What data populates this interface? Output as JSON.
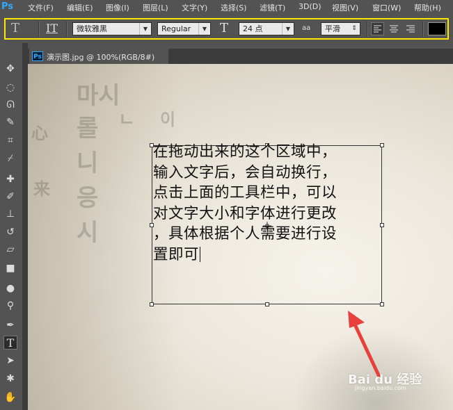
{
  "app": {
    "logo": "Ps"
  },
  "menu": {
    "items": [
      "文件(F)",
      "编辑(E)",
      "图像(I)",
      "图层(L)",
      "文字(Y)",
      "选择(S)",
      "滤镜(T)",
      "3D(D)",
      "视图(V)",
      "窗口(W)",
      "帮助(H)"
    ]
  },
  "options": {
    "tool_icon": "T",
    "orient_icon": "IT",
    "font_family": "微软雅黑",
    "font_style": "Regular",
    "size_icon": "T",
    "font_size": "24 点",
    "aa_icon": "aa",
    "antialias": "平滑",
    "text_color": "#000000"
  },
  "document": {
    "tab_badge": "Ps",
    "tab_title": "演示图.jpg @ 100%(RGB/8#)"
  },
  "textlayer": {
    "lines": [
      "在拖动出来的这个区域中，",
      "输入文字后，会自动换行，",
      "点击上面的工具栏中，可以",
      "对文字大小和字体进行更改",
      "，具体根据个人需要进行设",
      "置即可"
    ]
  },
  "watermark": {
    "text": "Bai du 经验",
    "sub": "jingyan.baidu.com"
  },
  "colors": {
    "arrow": "#e8403a",
    "highlight": "#ffe800"
  }
}
